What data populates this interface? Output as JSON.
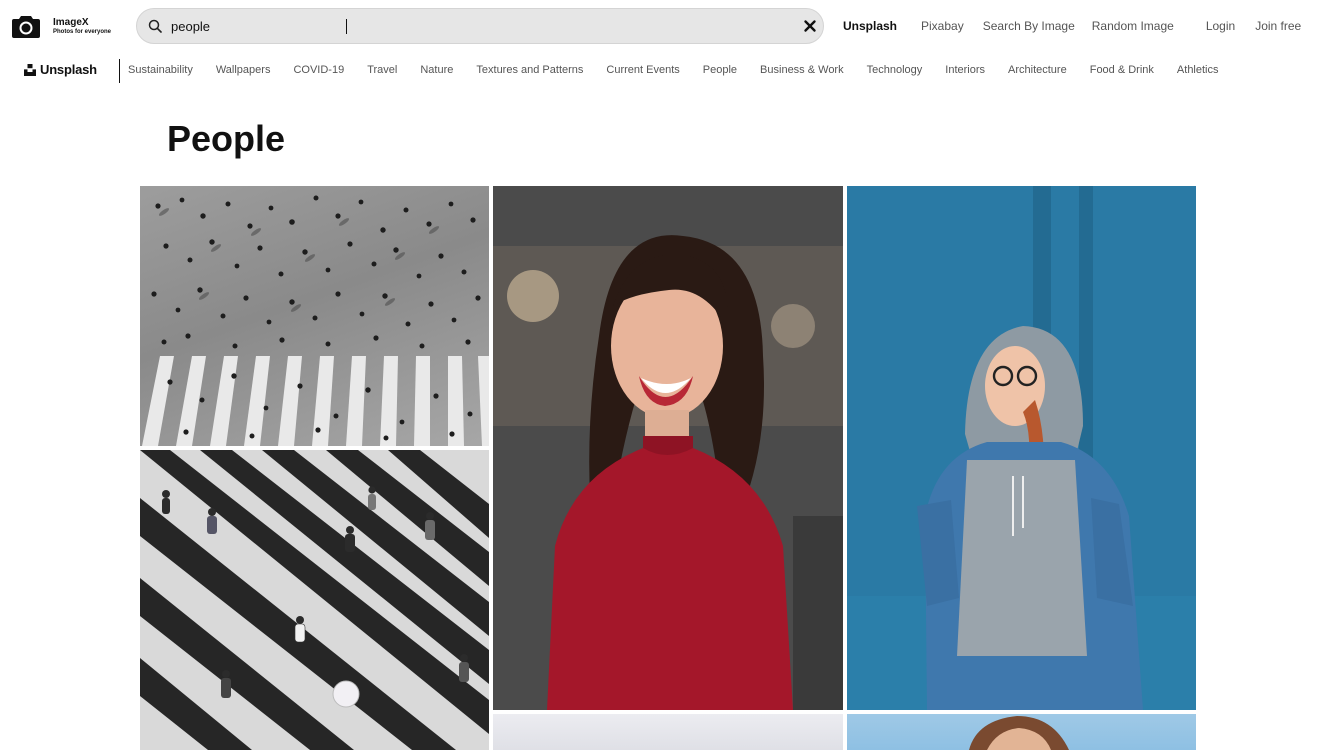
{
  "brand": {
    "name": "ImageX",
    "tagline": "Photos for everyone",
    "icon": "camera-icon"
  },
  "search": {
    "value": "people",
    "icon": "search-icon",
    "clear_icon": "close-icon"
  },
  "top_links": [
    {
      "label": "Unsplash",
      "active": true
    },
    {
      "label": "Pixabay",
      "active": false
    },
    {
      "label": "Search By Image",
      "active": false
    },
    {
      "label": "Random Image",
      "active": false
    },
    {
      "label": "Login",
      "active": false
    },
    {
      "label": "Join free",
      "active": false
    }
  ],
  "nav": {
    "logo_text": "Unsplash",
    "logo_icon": "unsplash-logo-icon",
    "items": [
      "Sustainability",
      "Wallpapers",
      "COVID-19",
      "Travel",
      "Nature",
      "Textures and Patterns",
      "Current Events",
      "People",
      "Business & Work",
      "Technology",
      "Interiors",
      "Architecture",
      "Food & Drink",
      "Athletics"
    ]
  },
  "page": {
    "title": "People"
  },
  "colors": {
    "search_bg": "#e6e6e6",
    "text_primary": "#111111",
    "text_secondary": "#555555",
    "photo_blue_wall": "#2a7aa5",
    "photo_red_top": "#a4172a"
  }
}
